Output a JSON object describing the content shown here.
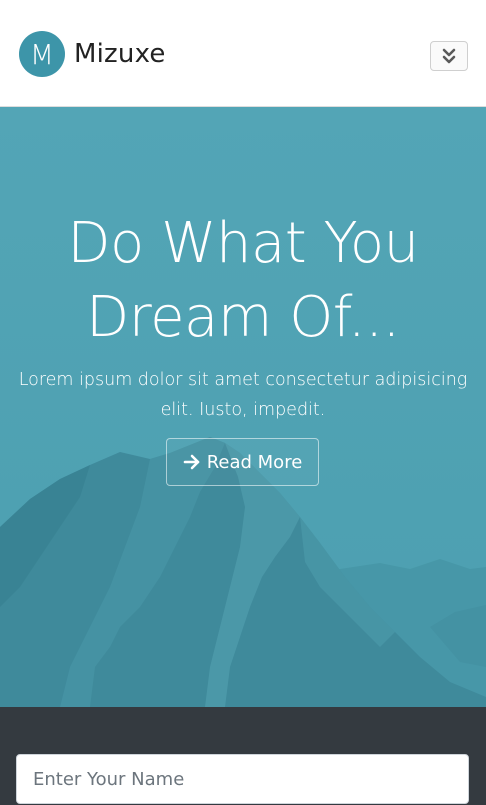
{
  "navbar": {
    "logo_letter": "M",
    "brand_name": "Mizuxe",
    "toggler_icon": "chevron-double-down-icon"
  },
  "hero": {
    "title_line1": "Do What You",
    "title_line2": "Dream Of...",
    "text_line1": "Lorem ipsum dolor sit amet consectetur adipisicing",
    "text_line2": "elit. Iusto, impedit.",
    "button_label": "Read More",
    "button_icon": "arrow-right-icon"
  },
  "signup": {
    "name_placeholder": "Enter Your Name",
    "name_value": ""
  },
  "colors": {
    "brand": "#3d95a9",
    "hero_overlay": "#4fa2b3",
    "dark_section": "#343a40"
  }
}
